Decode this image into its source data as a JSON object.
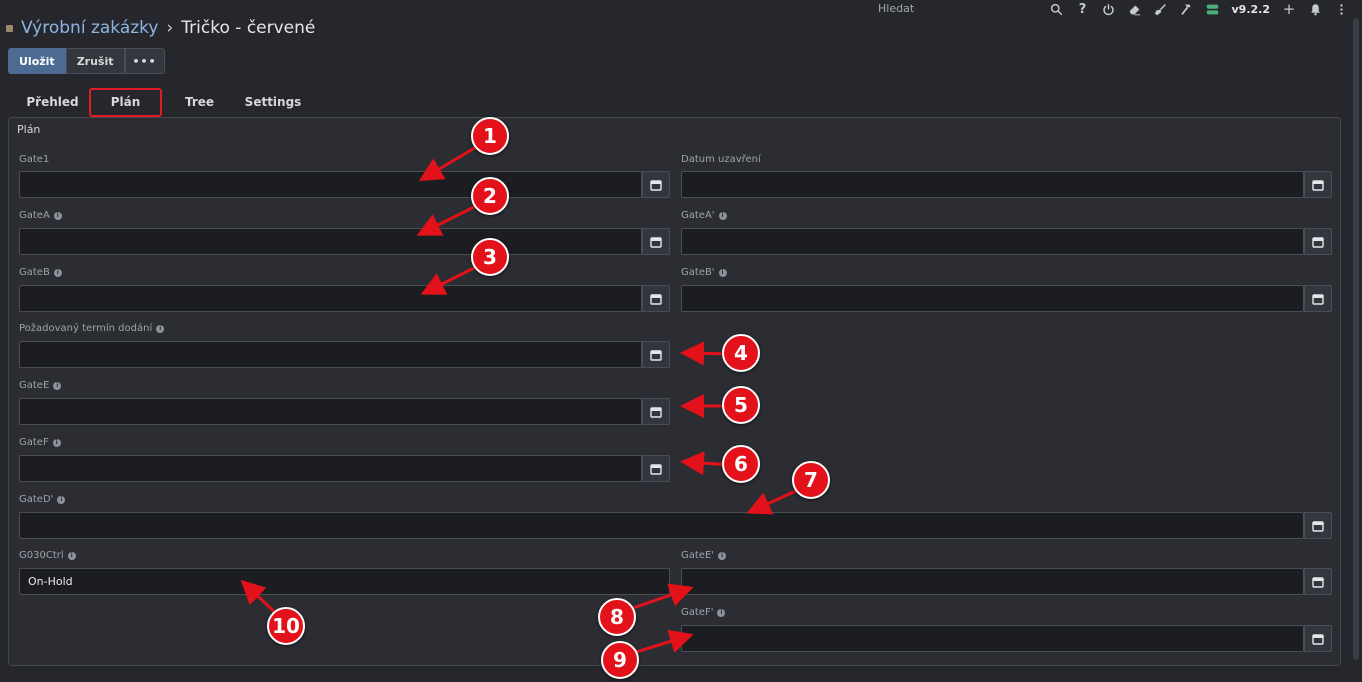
{
  "header": {
    "breadcrumb_parent": "Výrobní zakázky",
    "breadcrumb_sep": "›",
    "breadcrumb_current": "Tričko - červené",
    "search_placeholder": "Hledat",
    "version": "v9.2.2",
    "icons": [
      "search-icon",
      "help-icon",
      "power-icon",
      "eraser-icon",
      "broom-icon",
      "hammer-icon",
      "server-icon",
      "plus-icon",
      "bell-icon",
      "kebab-icon"
    ]
  },
  "toolbar": {
    "save_label": "Uložit",
    "cancel_label": "Zrušit",
    "more_label": "•••"
  },
  "tabs": [
    {
      "label": "Přehled",
      "active": false
    },
    {
      "label": "Plán",
      "active": true
    },
    {
      "label": "Tree",
      "active": false
    },
    {
      "label": "Settings",
      "active": false
    }
  ],
  "panel": {
    "title": "Plán",
    "fields": {
      "gate1": {
        "label": "Gate1",
        "value": ""
      },
      "datum_uzavreni": {
        "label": "Datum uzavření",
        "value": ""
      },
      "gateA": {
        "label": "GateA",
        "value": ""
      },
      "gateA_prime": {
        "label": "GateA'",
        "value": ""
      },
      "gateB": {
        "label": "GateB",
        "value": ""
      },
      "gateB_prime": {
        "label": "GateB'",
        "value": ""
      },
      "pozadovany_termin": {
        "label": "Požadovaný termín dodání",
        "value": ""
      },
      "gateE": {
        "label": "GateE",
        "value": ""
      },
      "gateF": {
        "label": "GateF",
        "value": ""
      },
      "gateD_prime": {
        "label": "GateD'",
        "value": ""
      },
      "g030ctrl": {
        "label": "G030Ctrl",
        "value": "On-Hold"
      },
      "gateE_prime": {
        "label": "GateE'",
        "value": ""
      },
      "gateF_prime": {
        "label": "GateF'",
        "value": ""
      }
    }
  },
  "annotations": [
    "1",
    "2",
    "3",
    "4",
    "5",
    "6",
    "7",
    "8",
    "9",
    "10"
  ],
  "colors": {
    "accent": "#4b6b93",
    "annotation_red": "#e3121a",
    "background": "#25272d",
    "input_bg": "#1c1d21"
  }
}
